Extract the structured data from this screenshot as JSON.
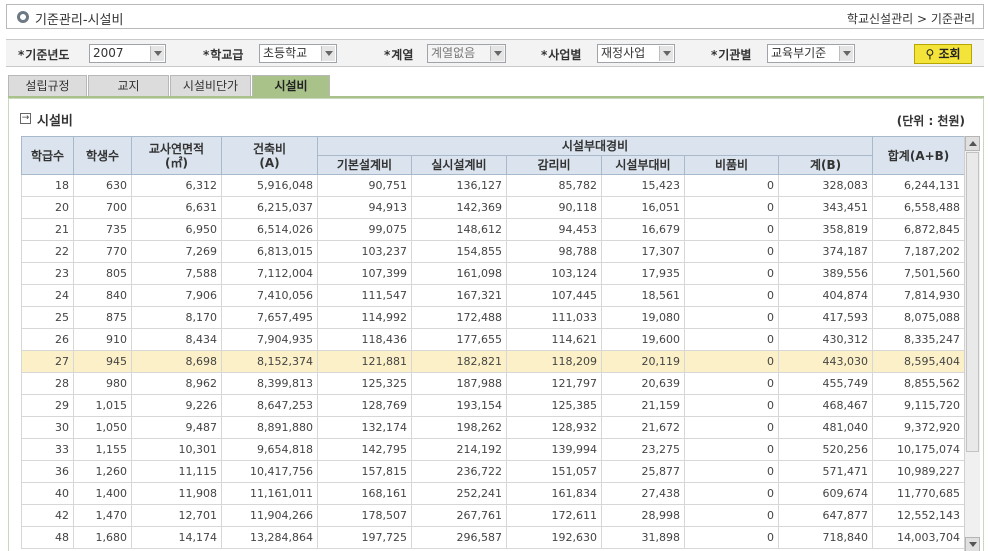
{
  "header": {
    "title": "기준관리-시설비",
    "breadcrumb": "학교신설관리 > 기준관리"
  },
  "filters": {
    "star": "*",
    "year_label": "기준년도",
    "year_value": "2007",
    "level_label": "학교급",
    "level_value": "초등학교",
    "series_label": "계열",
    "series_value": "계열없음",
    "biz_label": "사업별",
    "biz_value": "재정사업",
    "basis_label": "기관별",
    "basis_value": "교육부기준",
    "search_label": "조회"
  },
  "tabs": [
    {
      "label": "설립규정"
    },
    {
      "label": "교지"
    },
    {
      "label": "시설비단가"
    },
    {
      "label": "시설비"
    }
  ],
  "section": {
    "title": "시설비",
    "unit": "(단위 : 천원)"
  },
  "table": {
    "headers": {
      "classes": "학급수",
      "students": "학생수",
      "area": "교사연면적",
      "area_unit": "(㎡)",
      "construction": "건축비",
      "construction_sub": "(A)",
      "ancillary_group": "시설부대경비",
      "basic_design": "기본설계비",
      "detail_design": "실시설계비",
      "supervision": "감리비",
      "facility_aux": "시설부대비",
      "equipment": "비품비",
      "subtotal": "계(B)",
      "total": "합계(A+B)"
    },
    "rows": [
      [
        "18",
        "630",
        "6,312",
        "5,916,048",
        "90,751",
        "136,127",
        "85,782",
        "15,423",
        "0",
        "328,083",
        "6,244,131"
      ],
      [
        "20",
        "700",
        "6,631",
        "6,215,037",
        "94,913",
        "142,369",
        "90,118",
        "16,051",
        "0",
        "343,451",
        "6,558,488"
      ],
      [
        "21",
        "735",
        "6,950",
        "6,514,026",
        "99,075",
        "148,612",
        "94,453",
        "16,679",
        "0",
        "358,819",
        "6,872,845"
      ],
      [
        "22",
        "770",
        "7,269",
        "6,813,015",
        "103,237",
        "154,855",
        "98,788",
        "17,307",
        "0",
        "374,187",
        "7,187,202"
      ],
      [
        "23",
        "805",
        "7,588",
        "7,112,004",
        "107,399",
        "161,098",
        "103,124",
        "17,935",
        "0",
        "389,556",
        "7,501,560"
      ],
      [
        "24",
        "840",
        "7,906",
        "7,410,056",
        "111,547",
        "167,321",
        "107,445",
        "18,561",
        "0",
        "404,874",
        "7,814,930"
      ],
      [
        "25",
        "875",
        "8,170",
        "7,657,495",
        "114,992",
        "172,488",
        "111,033",
        "19,080",
        "0",
        "417,593",
        "8,075,088"
      ],
      [
        "26",
        "910",
        "8,434",
        "7,904,935",
        "118,436",
        "177,655",
        "114,621",
        "19,600",
        "0",
        "430,312",
        "8,335,247"
      ],
      [
        "27",
        "945",
        "8,698",
        "8,152,374",
        "121,881",
        "182,821",
        "118,209",
        "20,119",
        "0",
        "443,030",
        "8,595,404"
      ],
      [
        "28",
        "980",
        "8,962",
        "8,399,813",
        "125,325",
        "187,988",
        "121,797",
        "20,639",
        "0",
        "455,749",
        "8,855,562"
      ],
      [
        "29",
        "1,015",
        "9,226",
        "8,647,253",
        "128,769",
        "193,154",
        "125,385",
        "21,159",
        "0",
        "468,467",
        "9,115,720"
      ],
      [
        "30",
        "1,050",
        "9,487",
        "8,891,880",
        "132,174",
        "198,262",
        "128,932",
        "21,672",
        "0",
        "481,040",
        "9,372,920"
      ],
      [
        "33",
        "1,155",
        "10,301",
        "9,654,818",
        "142,795",
        "214,192",
        "139,994",
        "23,275",
        "0",
        "520,256",
        "10,175,074"
      ],
      [
        "36",
        "1,260",
        "11,115",
        "10,417,756",
        "157,815",
        "236,722",
        "151,057",
        "25,877",
        "0",
        "571,471",
        "10,989,227"
      ],
      [
        "40",
        "1,400",
        "11,908",
        "11,161,011",
        "168,161",
        "252,241",
        "161,834",
        "27,438",
        "0",
        "609,674",
        "11,770,685"
      ],
      [
        "42",
        "1,470",
        "12,701",
        "11,904,266",
        "178,507",
        "267,761",
        "172,611",
        "28,998",
        "0",
        "647,877",
        "12,552,143"
      ],
      [
        "48",
        "1,680",
        "14,174",
        "13,284,864",
        "197,725",
        "296,587",
        "192,630",
        "31,898",
        "0",
        "718,840",
        "14,003,704"
      ]
    ],
    "highlighted_row": 8
  },
  "colors": {
    "header_bg": "#dbe4ee",
    "active_tab": "#a9c28a",
    "highlight_row": "#fbf0c8",
    "search_button": "#f4e43a"
  }
}
